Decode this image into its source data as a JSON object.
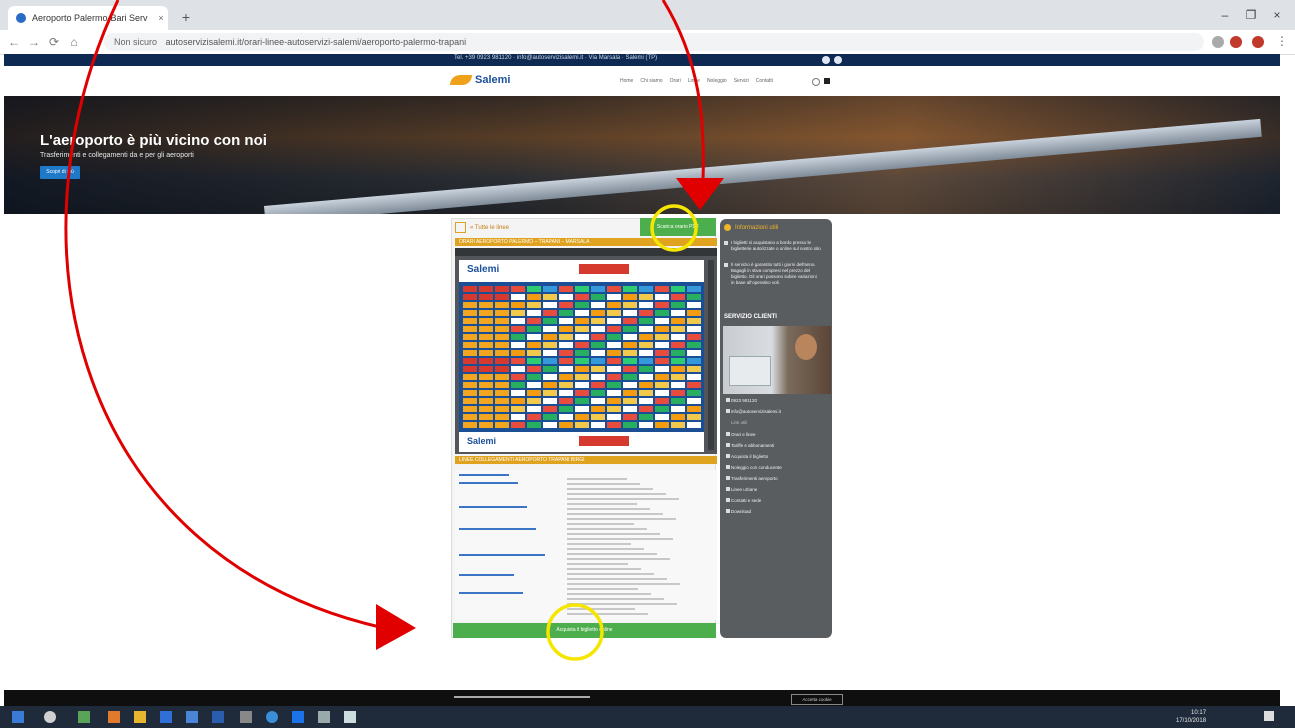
{
  "browser": {
    "tab_title": "Aeroporto Palermo-Bari Serv",
    "tab_close": "×",
    "new_tab": "+",
    "url_secure": "Non sicuro",
    "url": "autoservizisalemi.it/orari-linee-autoservizi-salemi/aeroporto-palermo-trapani",
    "window_buttons": [
      "–",
      "❐",
      "×"
    ],
    "nav": [
      "←",
      "→",
      "⟳",
      "⌂"
    ]
  },
  "site": {
    "top_strip_text": "Tel. +39 0923 981120 · info@autoservizisalemi.it · Via Marsala · Salemi (TP)",
    "logo": "Salemi",
    "nav_items": [
      "Home",
      "Chi siamo",
      "Orari",
      "Linee",
      "Noleggio",
      "Servizi",
      "Contatti"
    ],
    "hero_title": "L'aeroporto è più vicino con noi",
    "hero_subtitle": "Trasferimenti e collegamenti da e per gli aeroporti",
    "hero_button": "Scopri di più",
    "breadcrumb": "« Tutte le linee",
    "green_button": "Scarica orario PDF",
    "section1_title": "ORARI AEROPORTO PALERMO – TRAPANI – MARSALA",
    "section2_title": "LINEE COLLEGAMENTI AEROPORTO TRAPANI BIRGI",
    "pdf_logo": "Salemi",
    "bottom_button": "Acquista il biglietto online",
    "cookie_button": "Accetta cookie"
  },
  "sidebar": {
    "heading": "Informazioni utili",
    "items": [
      "I biglietti si acquistano a bordo presso le biglietterie autorizzate o online sul nostro sito",
      "Il servizio è garantito tutti i giorni dell'anno. Bagagli in stiva compresi nel prezzo del biglietto. Gli orari possono subire variazioni in base all'operativo voli."
    ],
    "service_title": "SERVIZIO CLIENTI",
    "contacts": [
      "0923 981120",
      "info@autoservizisalemi.it"
    ],
    "links_label": "Link utili",
    "links": [
      "Orari e linee",
      "Tariffe e abbonamenti",
      "Acquista il biglietto",
      "Noleggio con conducente",
      "Trasferimenti aeroporto",
      "Linee urbane",
      "Contatti e sede",
      "Download"
    ]
  },
  "taskbar": {
    "time": "10:17",
    "date": "17/10/2018"
  },
  "colors": {
    "annotation_red": "#e00000",
    "annotation_yellow": "#f5e600",
    "green": "#4cae4c",
    "gold": "#e0a31f",
    "navy": "#0e2a52"
  }
}
